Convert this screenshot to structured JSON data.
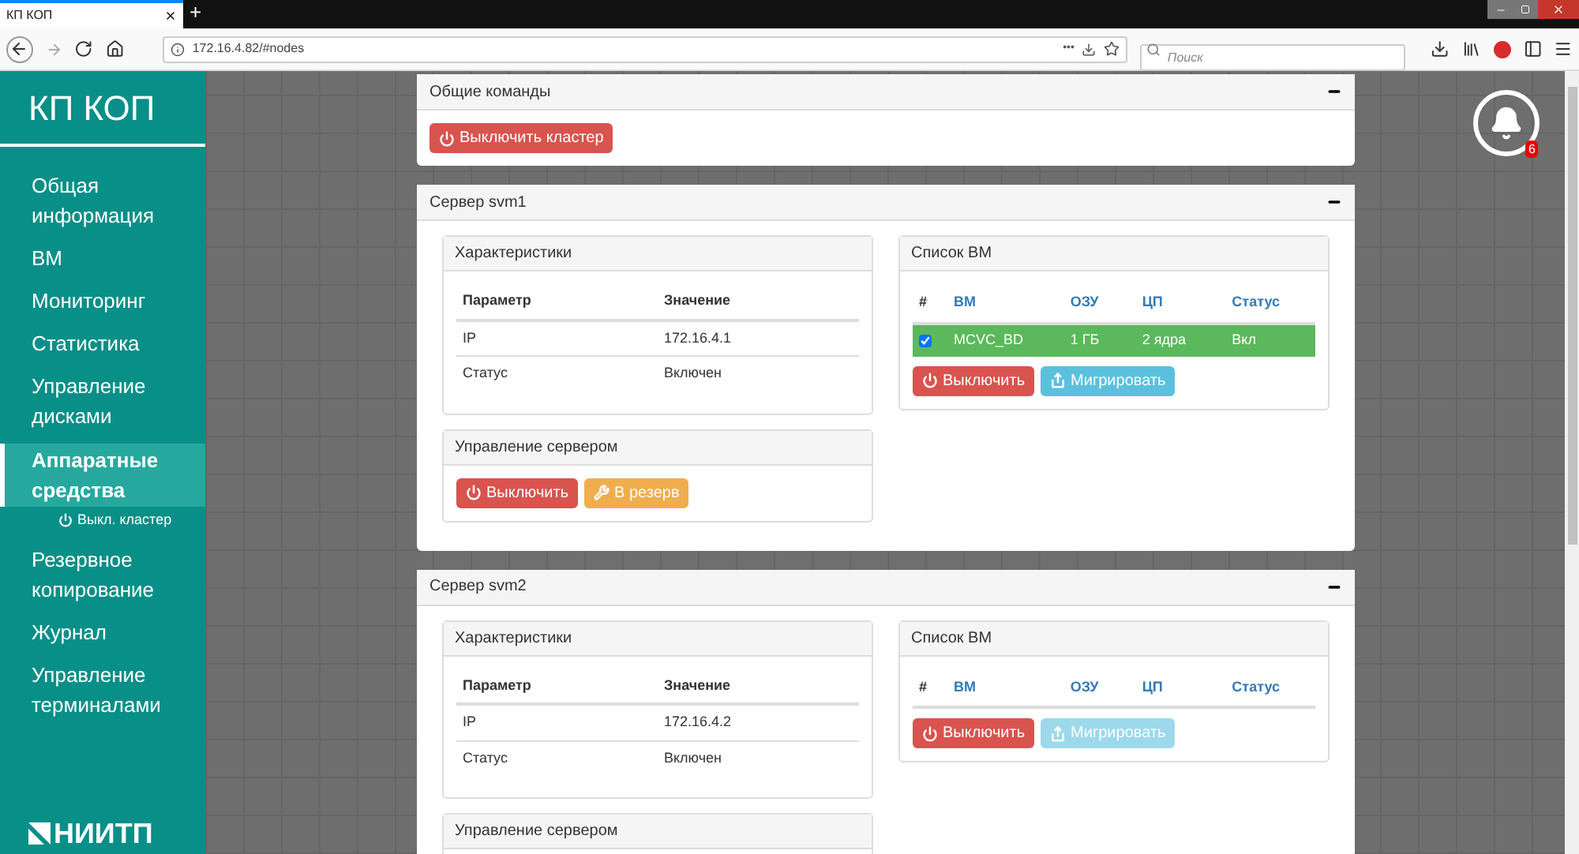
{
  "browser": {
    "tab_title": "КП КОП",
    "new_tab": "+",
    "url": "172.16.4.82/#nodes",
    "more": "•••",
    "search": {
      "placeholder": "Поиск"
    }
  },
  "sidebar": {
    "title": "КП КОП",
    "items": [
      {
        "label": "Общая информация",
        "selected": false
      },
      {
        "label": "ВМ",
        "selected": false
      },
      {
        "label": "Мониторинг",
        "selected": false
      },
      {
        "label": "Статистика",
        "selected": false
      },
      {
        "label": "Управление дисками",
        "selected": false
      },
      {
        "label": "Аппаратные средства",
        "selected": true,
        "children": [
          {
            "label": "Выкл. кластер"
          }
        ]
      },
      {
        "label": "Резервное копирование",
        "selected": false
      },
      {
        "label": "Журнал",
        "selected": false
      },
      {
        "label": "Управление терминалами",
        "selected": false
      }
    ],
    "logo": "НИИТП"
  },
  "notifications": {
    "count": "6"
  },
  "general_panel": {
    "title": "Общие команды",
    "buttons": [
      {
        "label": "Выключить кластер",
        "kind": "shutdown",
        "disabled": false
      }
    ]
  },
  "servers": [
    {
      "title": "Сервер svm1",
      "specs": {
        "title": "Характеристики",
        "columns": [
          "Параметр",
          "Значение"
        ],
        "rows": [
          [
            "IP",
            "172.16.4.1"
          ],
          [
            "Статус",
            "Включен"
          ]
        ]
      },
      "control": {
        "title": "Управление сервером",
        "buttons": [
          {
            "label": "Выключить",
            "kind": "shutdown",
            "disabled": false
          },
          {
            "label": "В резерв",
            "kind": "reserve",
            "disabled": false
          }
        ]
      },
      "vm_list": {
        "title": "Список ВМ",
        "columns": [
          "#",
          "ВМ",
          "ОЗУ",
          "ЦП",
          "Статус"
        ],
        "rows": [
          {
            "checked": true,
            "selected": true,
            "name": "MCVC_BD",
            "ram": "1 ГБ",
            "cpu": "2 ядра",
            "status": "Вкл"
          }
        ],
        "buttons": [
          {
            "label": "Выключить",
            "kind": "shutdown",
            "disabled": false
          },
          {
            "label": "Мигрировать",
            "kind": "migrate",
            "disabled": false
          }
        ]
      }
    },
    {
      "title": "Сервер svm2",
      "specs": {
        "title": "Характеристики",
        "columns": [
          "Параметр",
          "Значение"
        ],
        "rows": [
          [
            "IP",
            "172.16.4.2"
          ],
          [
            "Статус",
            "Включен"
          ]
        ]
      },
      "control": {
        "title": "Управление сервером"
      },
      "vm_list": {
        "title": "Список ВМ",
        "columns": [
          "#",
          "ВМ",
          "ОЗУ",
          "ЦП",
          "Статус"
        ],
        "buttons": [
          {
            "label": "Выключить",
            "kind": "shutdown",
            "disabled": false
          },
          {
            "label": "Мигрировать",
            "kind": "migrate",
            "disabled": true
          }
        ]
      }
    }
  ]
}
